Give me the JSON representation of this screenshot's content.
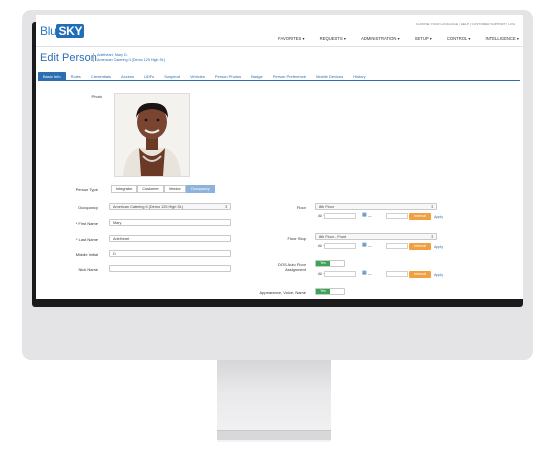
{
  "header": {
    "logo_part1": "Blu",
    "logo_part2": "SKY",
    "utility": "CHOOSE YOUR LANGUAGE  |  HELP  |  CUSTOMER SUPPORT  |  LOG",
    "nav": [
      "FAVORITES ▾",
      "REQUESTS ▾",
      "ADMINISTRATION ▾",
      "SETUP ▾",
      "CONTROL ▾",
      "INTELLIGENCE ▾"
    ]
  },
  "page": {
    "title": "Edit Person",
    "person_name": "Adelheart, Mary D.",
    "person_company": "American Catering II (Demo 125 High St.)"
  },
  "tabs": [
    "Basic Info",
    "Roles",
    "Credentials",
    "Access",
    "UDFs",
    "Suspend",
    "Vehicles",
    "Person Photos",
    "Badge",
    "Person Preference",
    "Mobile Devices",
    "History"
  ],
  "form": {
    "photo_label": "Photo",
    "person_type_label": "Person Type",
    "person_types": [
      "Integrator",
      "Customer",
      "Vendor",
      "Occupancy"
    ],
    "occupancy_label": "Occupancy",
    "occupancy_value": "American Catering II (Demo 125 High St.)",
    "first_name_label": "* First Name",
    "first_name_value": "Mary",
    "last_name_label": "* Last Name",
    "last_name_value": "Adelheart",
    "middle_initial_label": "Middle Initial",
    "middle_initial_value": "D",
    "nick_name_label": "Nick Name",
    "nick_name_value": ""
  },
  "right": {
    "floor_label": "Floor",
    "floor_value": "8th Floor",
    "floor_all": "All ~",
    "floor_stop_label": "Floor Stop",
    "floor_stop_value": "8th Floor - Front",
    "floor_stop_all": "All ~",
    "dos_label_1": "DOS Auto Floor",
    "dos_label_2": "Assignment",
    "dos_value": "Yes",
    "dos_all": "All ~",
    "appearance_label": "Appearance, Voice, Name",
    "appearance_value": "Yes",
    "interval_label": "Interval",
    "apply_label": "Apply",
    "cal_suffix": " —"
  },
  "colors": {
    "accent": "#2b6fb3",
    "active_tab": "#2b6fb3",
    "orange_button": "#f0a040",
    "toggle_on": "#3aa655"
  }
}
